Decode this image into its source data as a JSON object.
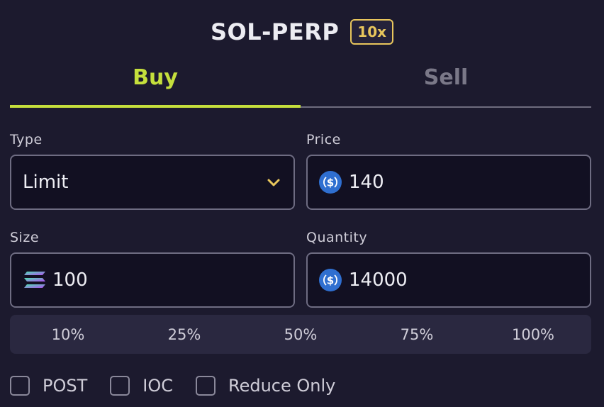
{
  "header": {
    "market": "SOL-PERP",
    "leverage": "10x"
  },
  "tabs": [
    {
      "label": "Buy",
      "active": true
    },
    {
      "label": "Sell",
      "active": false
    }
  ],
  "form": {
    "type": {
      "label": "Type",
      "value": "Limit"
    },
    "price": {
      "label": "Price",
      "value": "140",
      "icon": "usdc-icon"
    },
    "size": {
      "label": "Size",
      "value": "100",
      "icon": "sol-icon"
    },
    "quantity": {
      "label": "Quantity",
      "value": "14000",
      "icon": "usdc-icon"
    }
  },
  "percentages": [
    "10%",
    "25%",
    "50%",
    "75%",
    "100%"
  ],
  "options": [
    {
      "label": "POST",
      "checked": false
    },
    {
      "label": "IOC",
      "checked": false
    },
    {
      "label": "Reduce Only",
      "checked": false
    }
  ],
  "colors": {
    "background": "#1c1a2e",
    "accent": "#c5df3c",
    "leverage": "#e8c65c",
    "usdc": "#2f6fd0"
  }
}
